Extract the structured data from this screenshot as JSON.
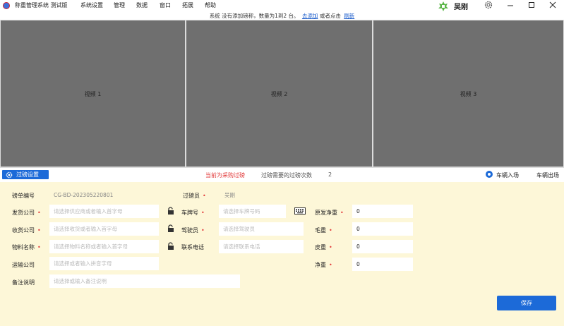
{
  "titlebar": {
    "app_title": "称重管理系统 测试版",
    "menu": [
      "系统设置",
      "管理",
      "数据",
      "窗口",
      "拓展",
      "帮助"
    ],
    "user_name": "吴刚"
  },
  "notice": {
    "text": "系统 没有添加磅称，数量为1到2 台。",
    "link_add": "去添加",
    "middle": "或者点击",
    "link_refresh": "刷新"
  },
  "videos": [
    "视频 1",
    "视频 2",
    "视频 3"
  ],
  "panel": {
    "settings_button": "过磅设置",
    "mode_text": "当前为采购过磅",
    "weigh_count_label": "过磅需要的过磅次数",
    "weigh_count_value": "2",
    "direction_in": "车辆入场",
    "direction_out": "车辆出场",
    "direction_selected": "车辆入场"
  },
  "form": {
    "bill_no": {
      "label": "磅单编号",
      "value": "CG-BD-202305220801"
    },
    "weigher": {
      "label": "过磅员",
      "value": "吴刚"
    },
    "sender": {
      "label": "发货公司",
      "placeholder": "请选择供应商或者输入首字母"
    },
    "plate": {
      "label": "车牌号",
      "placeholder": "请选择车牌号码"
    },
    "receiver": {
      "label": "收货公司",
      "placeholder": "请选择收货或者输入首字母"
    },
    "driver": {
      "label": "驾驶员",
      "placeholder": "请选择驾驶员"
    },
    "material": {
      "label": "物料名称",
      "placeholder": "请选择物料名称或者输入首字母"
    },
    "phone": {
      "label": "联系电话",
      "placeholder": "请选择联系电话"
    },
    "transport": {
      "label": "运输公司",
      "placeholder": "请选择或者输入拼音字母"
    },
    "remark": {
      "label": "备注说明",
      "placeholder": "请选择或输入备注说明"
    },
    "origin_net": {
      "label": "原发净重",
      "value": "0"
    },
    "gross": {
      "label": "毛重",
      "value": "0"
    },
    "tare": {
      "label": "皮重",
      "value": "0"
    },
    "net": {
      "label": "净重",
      "value": "0"
    },
    "save_button": "保存"
  },
  "colors": {
    "accent": "#1c6ad8",
    "required": "#e23a3a",
    "form_bg": "#fdf7d8",
    "video_bg": "#6f6f6f"
  },
  "icons": [
    "app-logo-icon",
    "brand-logo-icon",
    "gear-icon",
    "minimize-icon",
    "maximize-icon",
    "close-icon",
    "settings-gear-icon",
    "lock-icon",
    "keyboard-icon"
  ]
}
